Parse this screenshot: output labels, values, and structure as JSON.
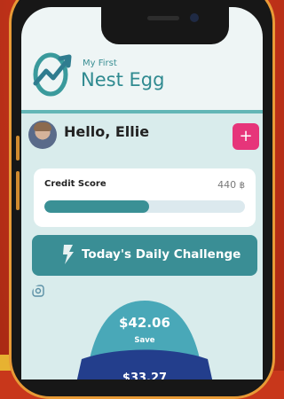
{
  "app": {
    "brand_small": "My First",
    "brand_large": "Nest Egg"
  },
  "greeting": {
    "text": "Hello, Ellie",
    "add_button": "+"
  },
  "credit": {
    "label": "Credit Score",
    "value": "440",
    "progress": 0.52
  },
  "challenge": {
    "label": "Today's Daily Challenge"
  },
  "egg": {
    "top_amount": "$42.06",
    "top_label": "Save",
    "next_amount": "$33.27"
  },
  "icons": [
    "nest-egg-logo-icon",
    "coin-icon",
    "lightning-icon",
    "target-icon"
  ],
  "colors": {
    "background": "#c8371b",
    "teal": "#3a8e95",
    "pink": "#e6357a",
    "egg_light": "#49a8b8",
    "egg_dark": "#233e8c"
  }
}
